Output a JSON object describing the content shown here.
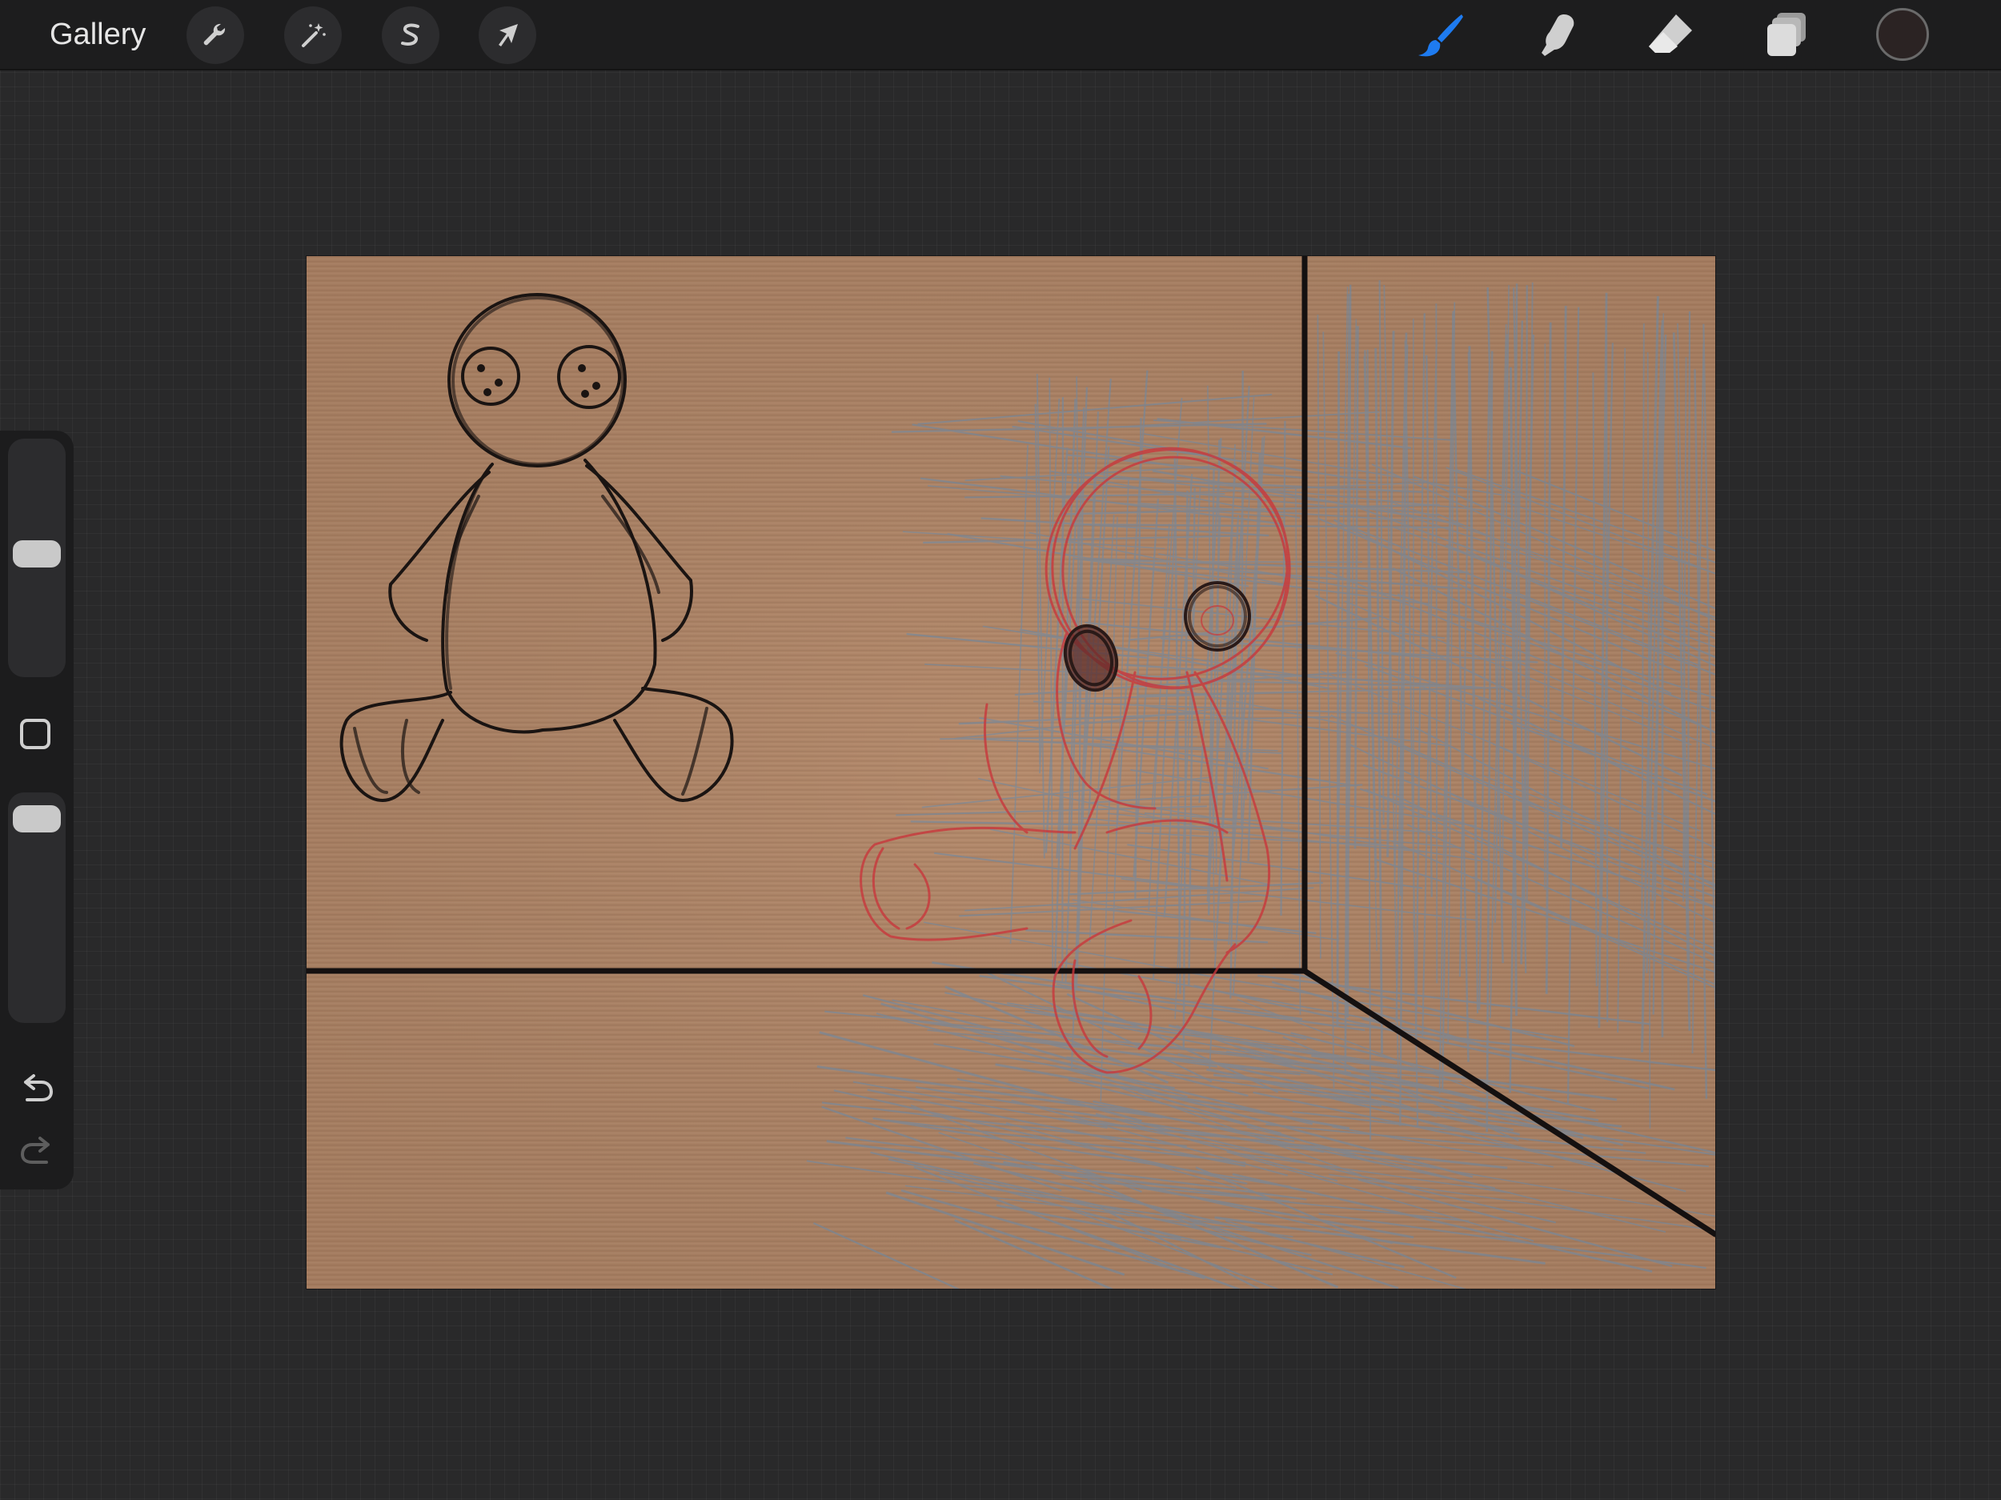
{
  "toolbar": {
    "gallery_label": "Gallery",
    "left_tools": [
      {
        "name": "actions",
        "icon": "wrench-icon"
      },
      {
        "name": "adjustments",
        "icon": "magic-wand-icon"
      },
      {
        "name": "selection",
        "icon": "selection-s-icon"
      },
      {
        "name": "transform",
        "icon": "arrow-cursor-icon"
      }
    ],
    "right_tools": [
      {
        "name": "brush",
        "icon": "brush-icon",
        "active": true
      },
      {
        "name": "smudge",
        "icon": "smudge-finger-icon",
        "active": false
      },
      {
        "name": "eraser",
        "icon": "eraser-icon",
        "active": false
      },
      {
        "name": "layers",
        "icon": "layers-icon",
        "active": false
      }
    ],
    "current_color": "#2b2323",
    "active_tool_color": "#1e7bf0"
  },
  "sidebar": {
    "brush_size_level": 0.52,
    "brush_opacity_level": 0.96,
    "modify_icon": "square-modify-icon",
    "undo_icon": "undo-arrow-icon",
    "redo_icon": "redo-arrow-icon"
  },
  "canvas": {
    "paper_color": "#b48a6c",
    "line_color": "#141010",
    "sketch_color_red": "#c8383c",
    "sketch_color_blue": "#6a8aa8"
  }
}
